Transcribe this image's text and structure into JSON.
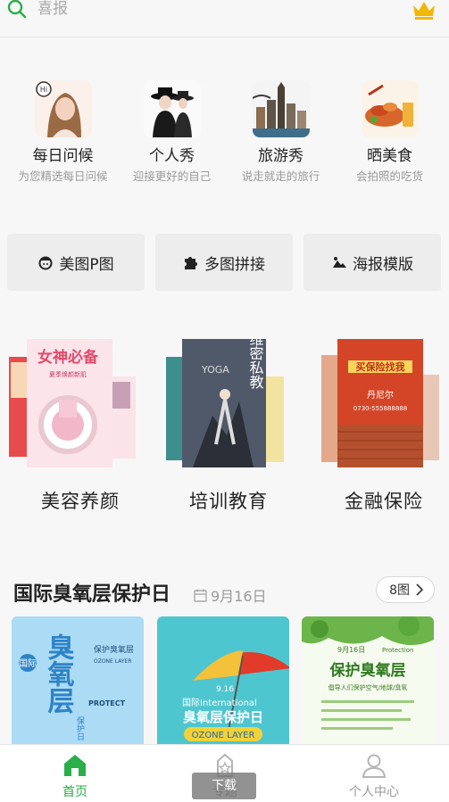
{
  "search": {
    "placeholder": "喜报"
  },
  "categories": [
    {
      "title": "每日问候",
      "subtitle": "为您精选每日问候"
    },
    {
      "title": "个人秀",
      "subtitle": "迎接更好的自己"
    },
    {
      "title": "旅游秀",
      "subtitle": "说走就走的旅行"
    },
    {
      "title": "晒美食",
      "subtitle": "会拍照的吃货"
    }
  ],
  "tools": [
    {
      "label": "美图P图",
      "icon": "face-icon"
    },
    {
      "label": "多图拼接",
      "icon": "puzzle-icon"
    },
    {
      "label": "海报模版",
      "icon": "image-icon"
    }
  ],
  "big_categories": [
    {
      "label": "美容养颜",
      "poster_text": "女神必备",
      "poster_sub": "夏季焕颜新肌"
    },
    {
      "label": "培训教育",
      "poster_text": "维密私教",
      "poster_sub": "YOGA"
    },
    {
      "label": "金融保险",
      "poster_text": "买保险找我",
      "poster_sub": "丹尼尔",
      "poster_phone": "0730-555888888"
    }
  ],
  "section": {
    "title": "国际臭氧层保护日",
    "date": "9月16日",
    "count": "8图"
  },
  "posters": [
    {
      "main": "臭氧层",
      "side": "国际",
      "right": "保护日",
      "en": "PROTECT",
      "head": "保护臭氧层",
      "sub": "OZONE LAYER"
    },
    {
      "main": "臭氧层保护日",
      "top": "国际International",
      "en": "OZONE LAYER",
      "date": "9.16"
    },
    {
      "main": "保护臭氧层",
      "date": "9月16日",
      "tag": "Protection",
      "sub": "倡导人们保护空气/地球/臭氧"
    }
  ],
  "nav": [
    {
      "label": "首页",
      "active": true
    },
    {
      "label": "专题",
      "active": false
    },
    {
      "label": "个人中心",
      "active": false
    }
  ],
  "toast": "下载",
  "colors": {
    "accent": "#2aae4a",
    "gold": "#f2b705"
  }
}
